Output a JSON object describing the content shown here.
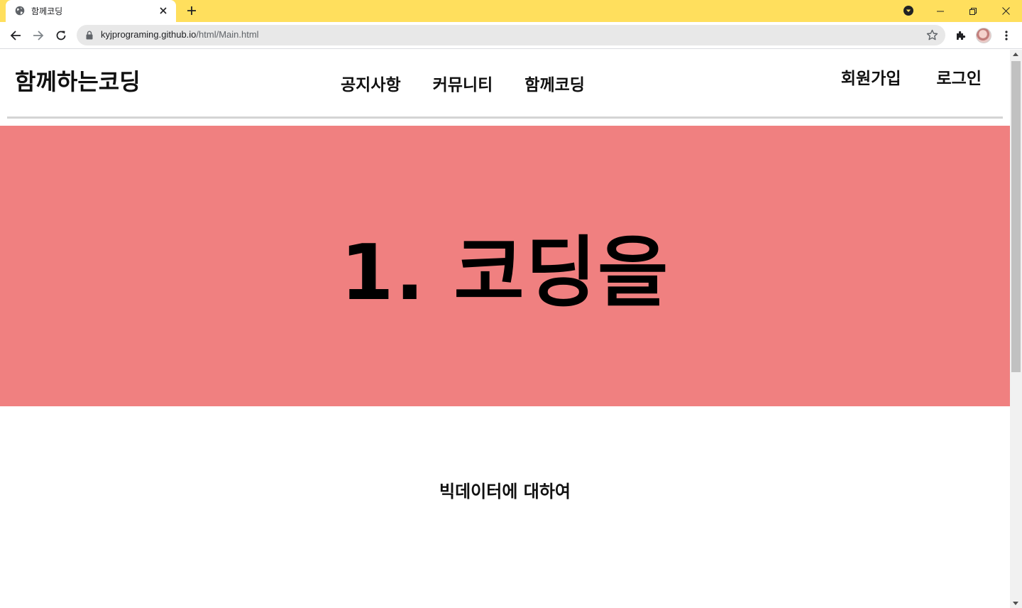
{
  "browser": {
    "tab_title": "함께코딩",
    "url_host": "kyjprograming.github.io",
    "url_path": "/html/Main.html",
    "theme_color": "#ffdf5d"
  },
  "site": {
    "logo": "함께하는코딩",
    "nav": [
      {
        "label": "공지사항"
      },
      {
        "label": "커뮤니티"
      },
      {
        "label": "함께코딩"
      }
    ],
    "auth": {
      "signup": "회원가입",
      "login": "로그인"
    },
    "hero": {
      "title": "1. 코딩을",
      "background": "#f08080"
    },
    "section_title": "빅데이터에 대하여"
  }
}
